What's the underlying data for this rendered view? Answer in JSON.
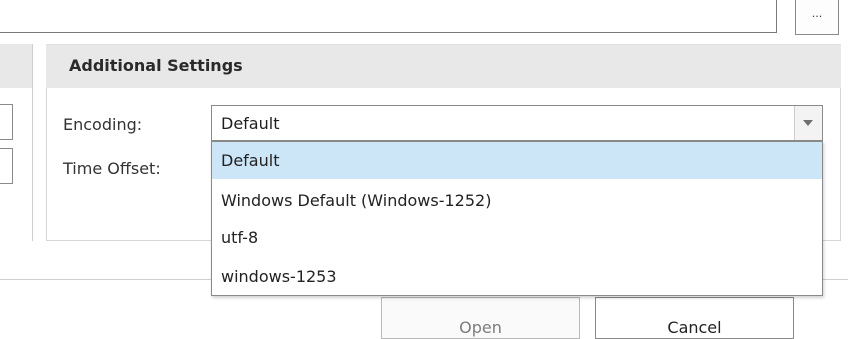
{
  "path_field": {
    "value": ""
  },
  "browse_button": {
    "label": "..."
  },
  "additional_settings": {
    "title": "Additional Settings",
    "encoding_label": "Encoding:",
    "time_offset_label": "Time Offset:",
    "encoding_select": {
      "selected_value": "Default",
      "options": [
        "Default",
        "Windows Default (Windows-1252)",
        "utf-8",
        "windows-1253"
      ],
      "highlighted_index": 0
    }
  },
  "footer": {
    "open_label": "Open",
    "cancel_label": "Cancel"
  },
  "colors": {
    "highlight": "#cce6f7",
    "header_bg": "#e8e8e8",
    "border": "#8a8a8a"
  }
}
